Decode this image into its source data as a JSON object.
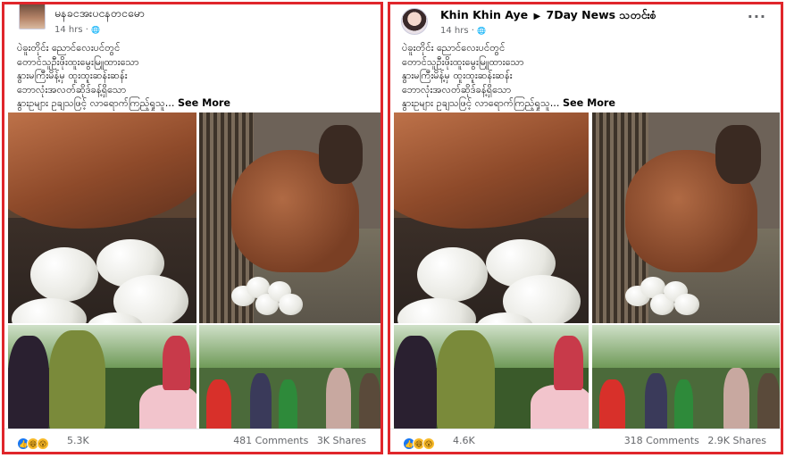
{
  "posts": [
    {
      "author": "မနခငအးပငနတငမော",
      "page": "",
      "time": "14 hrs · ",
      "globe": "🌐",
      "lines": [
        "ပဲခူးတိုင်း ညောင်လေးပင်တွင်",
        "တောင်သူဦးဖိုးထူးမွေးမြူထားသော",
        "နွားမကြီးမိန့်မှ ထူးထူးဆန်းဆန်း",
        "ဘောလုံးအလတ်ဆိုဒ်ခန့်ရှိသော",
        "နွားဥများ ဥချသဖြင့် လာရောက်ကြည့်ရှုသူ..."
      ],
      "see_more": "See More",
      "reaction_count": "5.3K",
      "comments": "481 Comments",
      "shares": "3K Shares",
      "reaction_icons": [
        "like-icon",
        "haha-icon",
        "wow-icon"
      ]
    },
    {
      "author": "Khin Khin Aye",
      "page": "7Day News သတင်းစံ",
      "arrow": "▶",
      "time": "14 hrs · ",
      "globe": "🌐",
      "more": "···",
      "lines": [
        "ပဲခူးတိုင်း ညောင်လေးပင်တွင်",
        "တောင်သူဦးဖိုးထူးမွေးမြူထားသော",
        "နွားမကြီးမိန့်မှ ထူးထူးဆန်းဆန်း",
        "ဘောလုံးအလတ်ဆိုဒ်ခန့်ရှိသော",
        "နွားဥများ ဥချသဖြင့် လာရောက်ကြည့်ရှုသူ..."
      ],
      "see_more": "See More",
      "reaction_count": "4.6K",
      "comments": "318 Comments",
      "shares": "2.9K Shares",
      "reaction_icons": [
        "like-icon",
        "haha-icon",
        "wow-icon"
      ]
    }
  ],
  "colors": {
    "highlight_border": "#e0262b",
    "secondary_text": "#65676b",
    "like_blue": "#1877f2"
  }
}
